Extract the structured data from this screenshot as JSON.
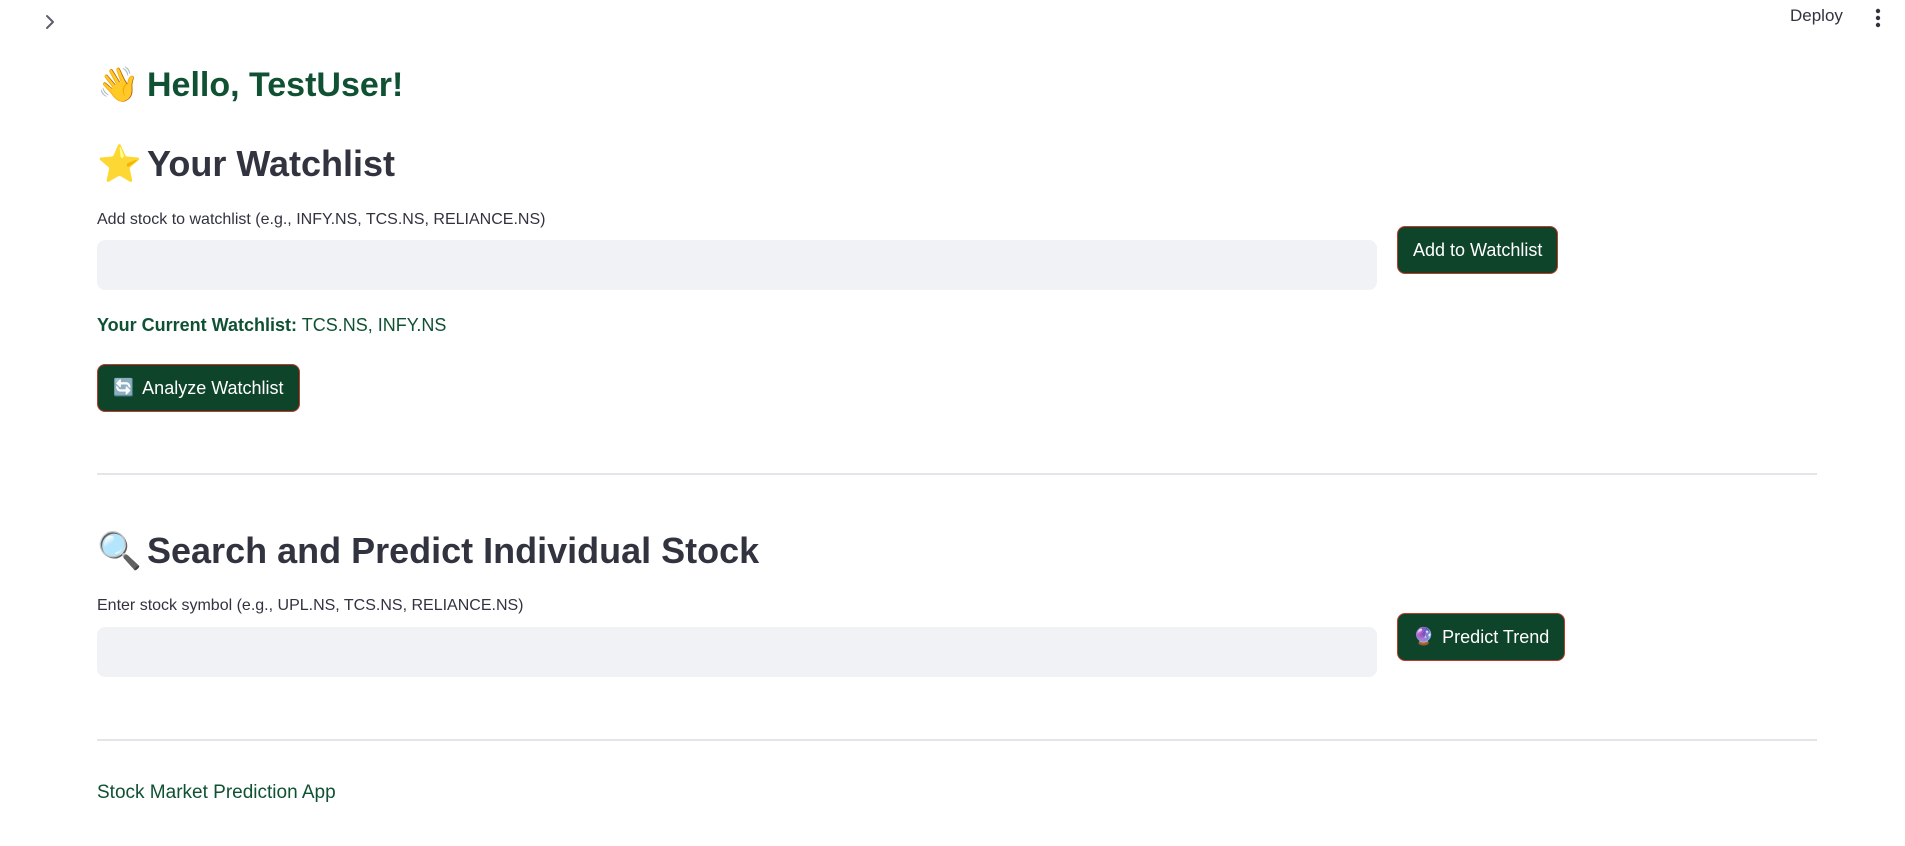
{
  "topbar": {
    "sidebar_toggle_icon": "chevron-right-icon",
    "deploy_label": "Deploy",
    "menu_icon": "kebab-menu-icon"
  },
  "greeting": {
    "emoji": "👋",
    "text": "Hello, TestUser!"
  },
  "watchlist": {
    "emoji": "⭐",
    "heading": "Your Watchlist",
    "input_label": "Add stock to watchlist (e.g., INFY.NS, TCS.NS, RELIANCE.NS)",
    "input_value": "",
    "add_button_label": "Add to Watchlist",
    "current_label": "Your Current Watchlist:",
    "current_value": "TCS.NS, INFY.NS",
    "analyze_icon": "🔄",
    "analyze_button_label": "Analyze Watchlist"
  },
  "search": {
    "emoji": "🔍",
    "heading": "Search and Predict Individual Stock",
    "input_label": "Enter stock symbol (e.g., UPL.NS, TCS.NS, RELIANCE.NS)",
    "input_value": "",
    "predict_icon": "🔮",
    "predict_button_label": "Predict Trend"
  },
  "footer": {
    "text": "Stock Market Prediction App"
  },
  "colors": {
    "accent_green": "#0f5132",
    "button_bg": "#0e4429",
    "button_border": "#c0392b",
    "input_bg": "#f0f2f6",
    "divider": "#e3e5e8"
  }
}
